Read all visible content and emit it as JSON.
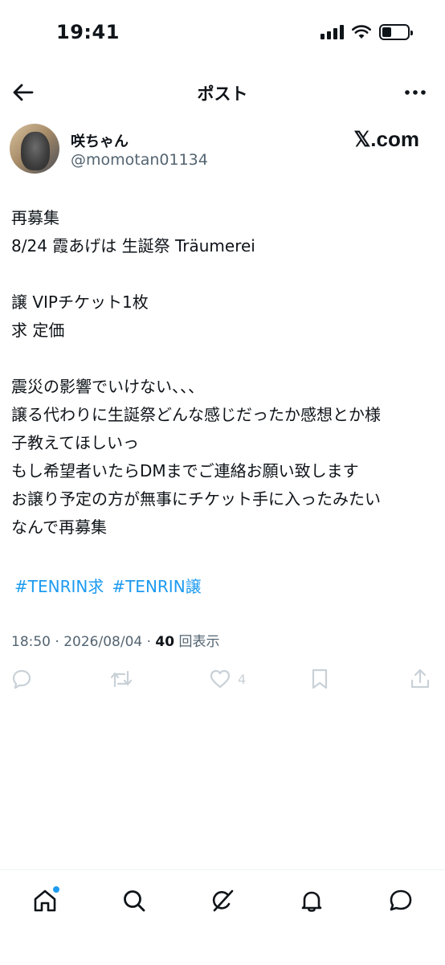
{
  "status_bar": {
    "time": "19:41",
    "battery_level": 0.35
  },
  "header": {
    "title": "ポスト"
  },
  "author": {
    "display_name": "咲ちゃん",
    "handle": "@momotan01134",
    "source_logo": "𝕏.com"
  },
  "post": {
    "lines": [
      "再募集",
      "8/24 霞あげは 生誕祭 Träumerei",
      "",
      "譲 VIPチケット1枚",
      "求 定価",
      "",
      "震災の影響でいけない、、、",
      "譲る代わりに生誕祭どんな感じだったか感想とか様",
      "子教えてほしいっ",
      "もし希望者いたらDMまでご連絡お願い致します",
      "お譲り予定の方が無事にチケット手に入ったみたい",
      "なんで再募集"
    ],
    "hashtags": [
      "#TENRIN求",
      "#TENRIN譲"
    ],
    "time": "18:50",
    "date": "2026/08/04",
    "views_count": "40",
    "views_label": "回表示"
  },
  "actions": {
    "reply_icon": "reply-icon",
    "repost_icon": "repost-icon",
    "like_icon": "heart-icon",
    "like_count": "4",
    "bookmark_icon": "bookmark-icon",
    "share_icon": "share-icon"
  },
  "bottom_nav": {
    "items": [
      "home-icon",
      "search-icon",
      "grok-icon",
      "notifications-icon",
      "messages-icon"
    ]
  },
  "colors": {
    "accent": "#1d9bf0",
    "text_primary": "#0f1419",
    "text_secondary": "#536471",
    "action_muted": "#c9d1d7"
  }
}
